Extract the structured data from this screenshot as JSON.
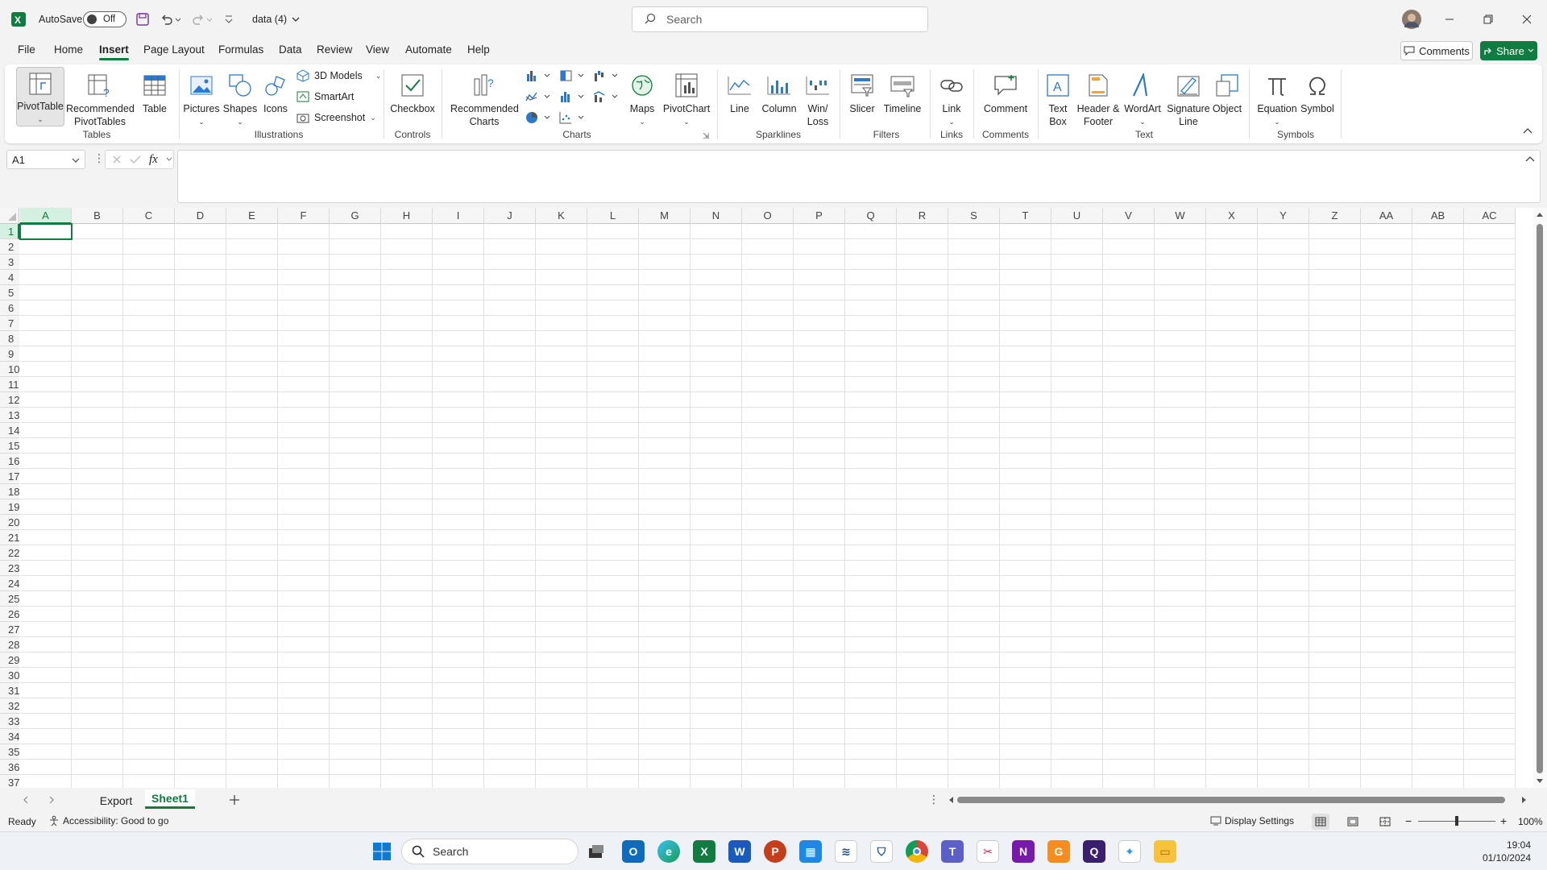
{
  "titlebar": {
    "autosave_label": "AutoSave",
    "autosave_state": "Off",
    "filename": "data (4)",
    "search_placeholder": "Search"
  },
  "menu": {
    "tabs": [
      "File",
      "Home",
      "Insert",
      "Page Layout",
      "Formulas",
      "Data",
      "Review",
      "View",
      "Automate",
      "Help"
    ],
    "active": "Insert",
    "comments": "Comments",
    "share": "Share"
  },
  "ribbon": {
    "pivottable": "PivotTable",
    "recommended_pivottables": "Recommended PivotTables",
    "table": "Table",
    "group_tables": "Tables",
    "pictures": "Pictures",
    "shapes": "Shapes",
    "icons": "Icons",
    "models3d": "3D Models",
    "smartart": "SmartArt",
    "screenshot": "Screenshot",
    "group_illustrations": "Illustrations",
    "checkbox": "Checkbox",
    "group_controls": "Controls",
    "recommended_charts": "Recommended Charts",
    "maps": "Maps",
    "pivotchart": "PivotChart",
    "group_charts": "Charts",
    "line": "Line",
    "column": "Column",
    "winloss": "Win/ Loss",
    "group_sparklines": "Sparklines",
    "slicer": "Slicer",
    "timeline": "Timeline",
    "group_filters": "Filters",
    "link": "Link",
    "group_links": "Links",
    "comment": "Comment",
    "group_comments": "Comments",
    "textbox": "Text Box",
    "header_footer": "Header & Footer",
    "wordart": "WordArt",
    "signature_line": "Signature Line",
    "object": "Object",
    "group_text": "Text",
    "equation": "Equation",
    "symbol": "Symbol",
    "group_symbols": "Symbols"
  },
  "formula": {
    "namebox": "A1",
    "fx": "fx"
  },
  "grid": {
    "columns": [
      "A",
      "B",
      "C",
      "D",
      "E",
      "F",
      "G",
      "H",
      "I",
      "J",
      "K",
      "L",
      "M",
      "N",
      "O",
      "P",
      "Q",
      "R",
      "S",
      "T",
      "U",
      "V",
      "W",
      "X",
      "Y",
      "Z",
      "AA",
      "AB",
      "AC"
    ],
    "rows": 37,
    "selected": "A1"
  },
  "sheets": {
    "tabs": [
      "Export",
      "Sheet1"
    ],
    "active": "Sheet1"
  },
  "status": {
    "ready": "Ready",
    "accessibility": "Accessibility: Good to go",
    "display_settings": "Display Settings",
    "zoom": "100%"
  },
  "taskbar": {
    "search": "Search",
    "time": "19:04",
    "date": "01/10/2024"
  }
}
